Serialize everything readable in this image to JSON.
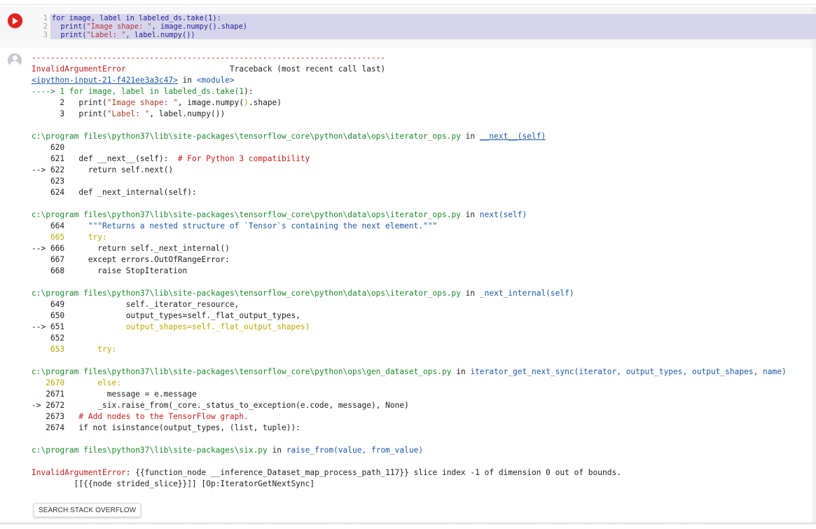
{
  "input": {
    "lines": [
      {
        "num": "1",
        "parts": [
          {
            "t": "for image, label in labeled_ds.take(1):",
            "c": ""
          }
        ]
      },
      {
        "num": "2",
        "parts": [
          {
            "t": "  print(",
            "c": ""
          },
          {
            "t": "\"Image shape: \"",
            "c": "str"
          },
          {
            "t": ", image.numpy().shape)",
            "c": ""
          }
        ]
      },
      {
        "num": "3",
        "parts": [
          {
            "t": "  print(",
            "c": ""
          },
          {
            "t": "\"Label: \"",
            "c": "str"
          },
          {
            "t": ", label.numpy())",
            "c": ""
          }
        ]
      }
    ]
  },
  "output": {
    "lines": [
      [
        {
          "t": "---------------------------------------------------------------------------",
          "c": "red"
        }
      ],
      [
        {
          "t": "InvalidArgumentError",
          "c": "red"
        },
        {
          "t": "                      Traceback (most recent call last)",
          "c": ""
        }
      ],
      [
        {
          "t": "<ipython-input-21-f421ee3a3c47>",
          "c": "blue",
          "u": true
        },
        {
          "t": " in ",
          "c": ""
        },
        {
          "t": "<module>",
          "c": "blue"
        }
      ],
      [
        {
          "t": "----> 1 for image, label in labeled_ds.take(",
          "c": "green"
        },
        {
          "t": "1",
          "c": "green"
        },
        {
          "t": "):",
          "c": ""
        }
      ],
      [
        {
          "t": "      2   print(",
          "c": ""
        },
        {
          "t": "\"Image shape: \"",
          "c": "brown"
        },
        {
          "t": ", image.numpy(",
          "c": ""
        },
        {
          "t": ")",
          "c": "yel"
        },
        {
          "t": ".shape)",
          "c": ""
        }
      ],
      [
        {
          "t": "      3   print(",
          "c": ""
        },
        {
          "t": "\"Label: \"",
          "c": "brown"
        },
        {
          "t": ", label.numpy())",
          "c": ""
        }
      ],
      [],
      [
        {
          "t": "c:\\program files\\python37\\lib\\site-packages\\tensorflow_core\\python\\data\\ops\\iterator_ops.py",
          "c": "green"
        },
        {
          "t": " in ",
          "c": ""
        },
        {
          "t": "__next__(self)",
          "c": "blue",
          "u": true
        }
      ],
      [
        {
          "t": "    620",
          "c": ""
        }
      ],
      [
        {
          "t": "    621   def __next__(self):  ",
          "c": ""
        },
        {
          "t": "# For Python 3 compatibility",
          "c": "red"
        }
      ],
      [
        {
          "t": "--> 622     return self.next()",
          "c": ""
        }
      ],
      [
        {
          "t": "    623",
          "c": ""
        }
      ],
      [
        {
          "t": "    624   def _next_internal(self):",
          "c": ""
        }
      ],
      [],
      [
        {
          "t": "c:\\program files\\python37\\lib\\site-packages\\tensorflow_core\\python\\data\\ops\\iterator_ops.py",
          "c": "green"
        },
        {
          "t": " in ",
          "c": ""
        },
        {
          "t": "next(self)",
          "c": "blue"
        }
      ],
      [
        {
          "t": "    664     ",
          "c": ""
        },
        {
          "t": "\"\"\"Returns a nested structure of `Tensor`s containing the next element.\"\"\"",
          "c": "blue"
        }
      ],
      [
        {
          "t": "    665     try:",
          "c": "yel"
        }
      ],
      [
        {
          "t": "--> 666       return self._next_internal()",
          "c": ""
        }
      ],
      [
        {
          "t": "    667     except errors.OutOfRangeError:",
          "c": ""
        }
      ],
      [
        {
          "t": "    668       raise StopIteration",
          "c": ""
        }
      ],
      [],
      [
        {
          "t": "c:\\program files\\python37\\lib\\site-packages\\tensorflow_core\\python\\data\\ops\\iterator_ops.py",
          "c": "green"
        },
        {
          "t": " in ",
          "c": ""
        },
        {
          "t": "_next_internal(self)",
          "c": "blue"
        }
      ],
      [
        {
          "t": "    649             self._iterator_resource,",
          "c": ""
        }
      ],
      [
        {
          "t": "    650             output_types=self._flat_output_types,",
          "c": ""
        }
      ],
      [
        {
          "t": "--> 651             ",
          "c": ""
        },
        {
          "t": "output_shapes=self._flat_output_shapes)",
          "c": "yel"
        }
      ],
      [
        {
          "t": "    652",
          "c": ""
        }
      ],
      [
        {
          "t": "    653       try:",
          "c": "yel"
        }
      ],
      [],
      [
        {
          "t": "c:\\program files\\python37\\lib\\site-packages\\tensorflow_core\\python\\ops\\gen_dataset_ops.py",
          "c": "green"
        },
        {
          "t": " in ",
          "c": ""
        },
        {
          "t": "iterator_get_next_sync(iterator, output_types, output_shapes, name)",
          "c": "blue"
        }
      ],
      [
        {
          "t": "   2670       else:",
          "c": "yel"
        }
      ],
      [
        {
          "t": "   2671         message = e.message",
          "c": ""
        }
      ],
      [
        {
          "t": "-> 2672       _six.raise_from(_core._status_to_exception(e.code, message), None)",
          "c": ""
        }
      ],
      [
        {
          "t": "   2673   ",
          "c": ""
        },
        {
          "t": "# Add nodes to the TensorFlow graph.",
          "c": "red"
        }
      ],
      [
        {
          "t": "   2674   if not isinstance(output_types, (list, tuple)):",
          "c": ""
        }
      ],
      [],
      [
        {
          "t": "c:\\program files\\python37\\lib\\site-packages\\six.py",
          "c": "green"
        },
        {
          "t": " in ",
          "c": ""
        },
        {
          "t": "raise_from(value, from_value)",
          "c": "blue"
        }
      ],
      [],
      [
        {
          "t": "InvalidArgumentError",
          "c": "red"
        },
        {
          "t": ": {{function_node __inference_Dataset_map_process_path_117}} slice index -1 of dimension 0 out of bounds.",
          "c": ""
        }
      ],
      [
        {
          "t": "\t [[{{node strided_slice}}]] [Op:IteratorGetNextSync]",
          "c": ""
        }
      ]
    ]
  },
  "buttons": {
    "search_stack_overflow": "SEARCH STACK OVERFLOW"
  },
  "icons": {
    "run": "play-icon",
    "output": "user-avatar-icon"
  },
  "colors": {
    "run_button": "#e62020",
    "highlight": "#d7d5ec"
  }
}
